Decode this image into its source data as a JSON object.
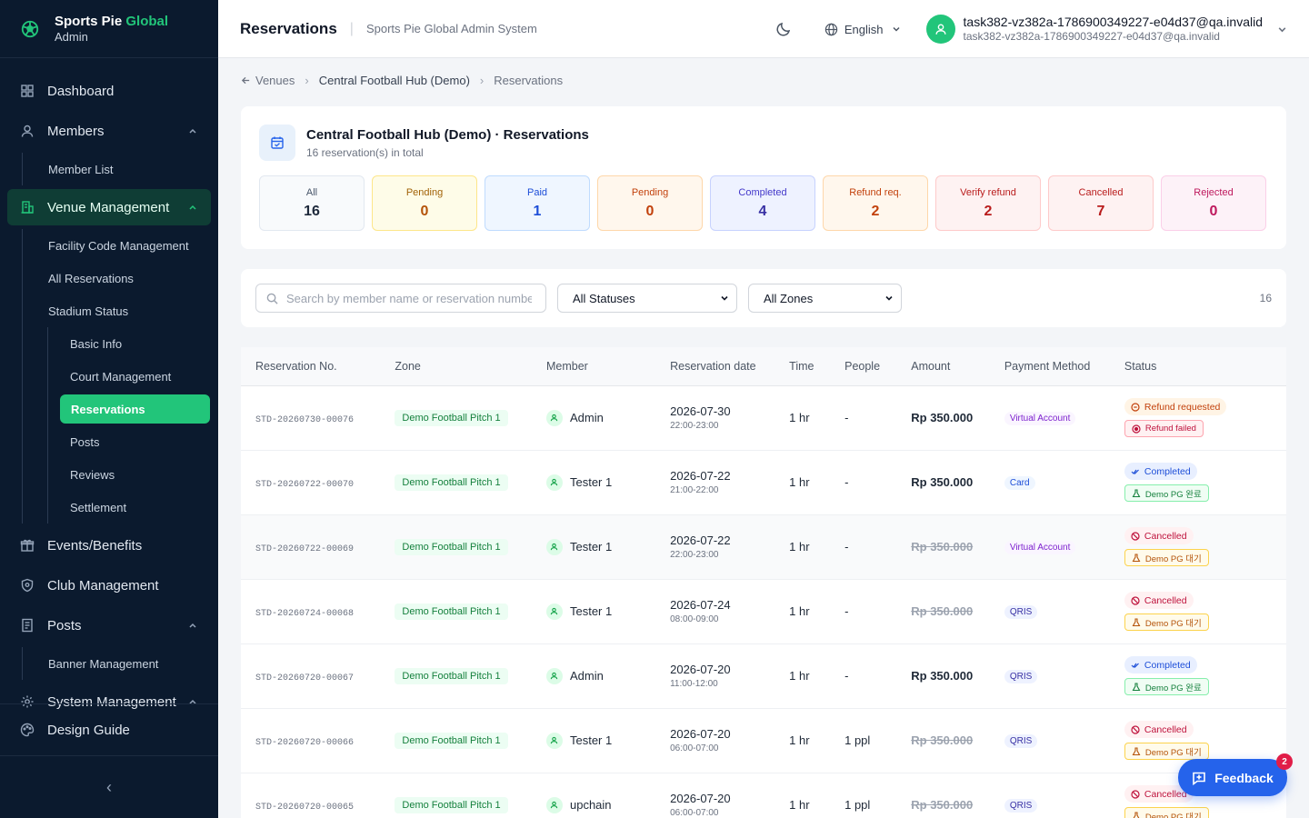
{
  "brand": {
    "name_main": "Sports Pie ",
    "name_accent": "Global",
    "sub": "Admin"
  },
  "sidebar": {
    "dashboard": "Dashboard",
    "members": "Members",
    "member_list": "Member List",
    "venue_management": "Venue Management",
    "facility_code": "Facility Code Management",
    "all_reservations": "All Reservations",
    "stadium_status": "Stadium Status",
    "basic_info": "Basic Info",
    "court_management": "Court Management",
    "reservations": "Reservations",
    "posts_sub": "Posts",
    "reviews": "Reviews",
    "settlement": "Settlement",
    "events": "Events/Benefits",
    "club": "Club Management",
    "posts": "Posts",
    "banner": "Banner Management",
    "system": "System Management",
    "design_guide": "Design Guide",
    "collapse": "‹"
  },
  "header": {
    "title": "Reservations",
    "subtitle": "Sports Pie Global Admin System",
    "language": "English",
    "user_name": "task382-vz382a-1786900349227-e04d37@qa.invalid",
    "user_email": "task382-vz382a-1786900349227-e04d37@qa.invalid"
  },
  "breadcrumb": {
    "venues": "Venues",
    "venue": "Central Football Hub (Demo)",
    "current": "Reservations"
  },
  "summary": {
    "title": "Central Football Hub (Demo) · Reservations",
    "count_text": "16 reservation(s) in total",
    "stats": [
      {
        "label": "All",
        "value": "16",
        "bg": "#f8fafc",
        "border": "#e2e8f0",
        "label_color": "#475569",
        "value_color": "#1e293b"
      },
      {
        "label": "Pending",
        "value": "0",
        "bg": "#fefce8",
        "border": "#fde68a",
        "label_color": "#a16207",
        "value_color": "#b45309"
      },
      {
        "label": "Paid",
        "value": "1",
        "bg": "#eff6ff",
        "border": "#bfdbfe",
        "label_color": "#1d4ed8",
        "value_color": "#1d4ed8"
      },
      {
        "label": "Pending",
        "value": "0",
        "bg": "#fff7ed",
        "border": "#fed7aa",
        "label_color": "#c2410c",
        "value_color": "#c2410c"
      },
      {
        "label": "Completed",
        "value": "4",
        "bg": "#eef2ff",
        "border": "#c7d2fe",
        "label_color": "#4338ca",
        "value_color": "#3730a3"
      },
      {
        "label": "Refund req.",
        "value": "2",
        "bg": "#fff7ed",
        "border": "#fed7aa",
        "label_color": "#c2410c",
        "value_color": "#c2410c"
      },
      {
        "label": "Verify refund",
        "value": "2",
        "bg": "#fef2f2",
        "border": "#fecaca",
        "label_color": "#b91c1c",
        "value_color": "#b91c1c"
      },
      {
        "label": "Cancelled",
        "value": "7",
        "bg": "#fef2f2",
        "border": "#fecaca",
        "label_color": "#b91c1c",
        "value_color": "#b91c1c"
      },
      {
        "label": "Rejected",
        "value": "0",
        "bg": "#fdf2f8",
        "border": "#fbcfe8",
        "label_color": "#be185d",
        "value_color": "#be185d"
      }
    ]
  },
  "filters": {
    "search_placeholder": "Search by member name or reservation number",
    "status": "All Statuses",
    "zone": "All Zones",
    "total": "16"
  },
  "table": {
    "columns": [
      "Reservation No.",
      "Zone",
      "Member",
      "Reservation date",
      "Time",
      "People",
      "Amount",
      "Payment Method",
      "Status"
    ],
    "rows": [
      {
        "no": "STD-20260730-00076",
        "zone": "Demo Football Pitch 1",
        "member": "Admin",
        "date": "2026-07-30",
        "range": "22:00-23:00",
        "time": "1 hr",
        "people": "-",
        "amount": "Rp 350.000",
        "strike": false,
        "pay": "Virtual Account",
        "pay_type": "va",
        "status1": "Refund requested",
        "s1": "refreq",
        "status2": "Refund failed",
        "s2": "reffail",
        "hl": false
      },
      {
        "no": "STD-20260722-00070",
        "zone": "Demo Football Pitch 1",
        "member": "Tester 1",
        "date": "2026-07-22",
        "range": "21:00-22:00",
        "time": "1 hr",
        "people": "-",
        "amount": "Rp 350.000",
        "strike": false,
        "pay": "Card",
        "pay_type": "card",
        "status1": "Completed",
        "s1": "complete",
        "status2": "Demo PG 완료",
        "s2": "pgdone",
        "hl": false
      },
      {
        "no": "STD-20260722-00069",
        "zone": "Demo Football Pitch 1",
        "member": "Tester 1",
        "date": "2026-07-22",
        "range": "22:00-23:00",
        "time": "1 hr",
        "people": "-",
        "amount": "Rp 350.000",
        "strike": true,
        "pay": "Virtual Account",
        "pay_type": "va",
        "status1": "Cancelled",
        "s1": "cancel",
        "status2": "Demo PG 대기",
        "s2": "pgwait",
        "hl": true
      },
      {
        "no": "STD-20260724-00068",
        "zone": "Demo Football Pitch 1",
        "member": "Tester 1",
        "date": "2026-07-24",
        "range": "08:00-09:00",
        "time": "1 hr",
        "people": "-",
        "amount": "Rp 350.000",
        "strike": true,
        "pay": "QRIS",
        "pay_type": "qris",
        "status1": "Cancelled",
        "s1": "cancel",
        "status2": "Demo PG 대기",
        "s2": "pgwait",
        "hl": false
      },
      {
        "no": "STD-20260720-00067",
        "zone": "Demo Football Pitch 1",
        "member": "Admin",
        "date": "2026-07-20",
        "range": "11:00-12:00",
        "time": "1 hr",
        "people": "-",
        "amount": "Rp 350.000",
        "strike": false,
        "pay": "QRIS",
        "pay_type": "qris",
        "status1": "Completed",
        "s1": "complete",
        "status2": "Demo PG 완료",
        "s2": "pgdone",
        "hl": false
      },
      {
        "no": "STD-20260720-00066",
        "zone": "Demo Football Pitch 1",
        "member": "Tester 1",
        "date": "2026-07-20",
        "range": "06:00-07:00",
        "time": "1 hr",
        "people": "1 ppl",
        "amount": "Rp 350.000",
        "strike": true,
        "pay": "QRIS",
        "pay_type": "qris",
        "status1": "Cancelled",
        "s1": "cancel",
        "status2": "Demo PG 대기",
        "s2": "pgwait",
        "hl": false
      },
      {
        "no": "STD-20260720-00065",
        "zone": "Demo Football Pitch 1",
        "member": "upchain",
        "date": "2026-07-20",
        "range": "06:00-07:00",
        "time": "1 hr",
        "people": "1 ppl",
        "amount": "Rp 350.000",
        "strike": true,
        "pay": "QRIS",
        "pay_type": "qris",
        "status1": "Cancelled",
        "s1": "cancel",
        "status2": "Demo PG 대기",
        "s2": "pgwait",
        "hl": false
      }
    ]
  },
  "feedback": {
    "label": "Feedback",
    "count": "2"
  }
}
